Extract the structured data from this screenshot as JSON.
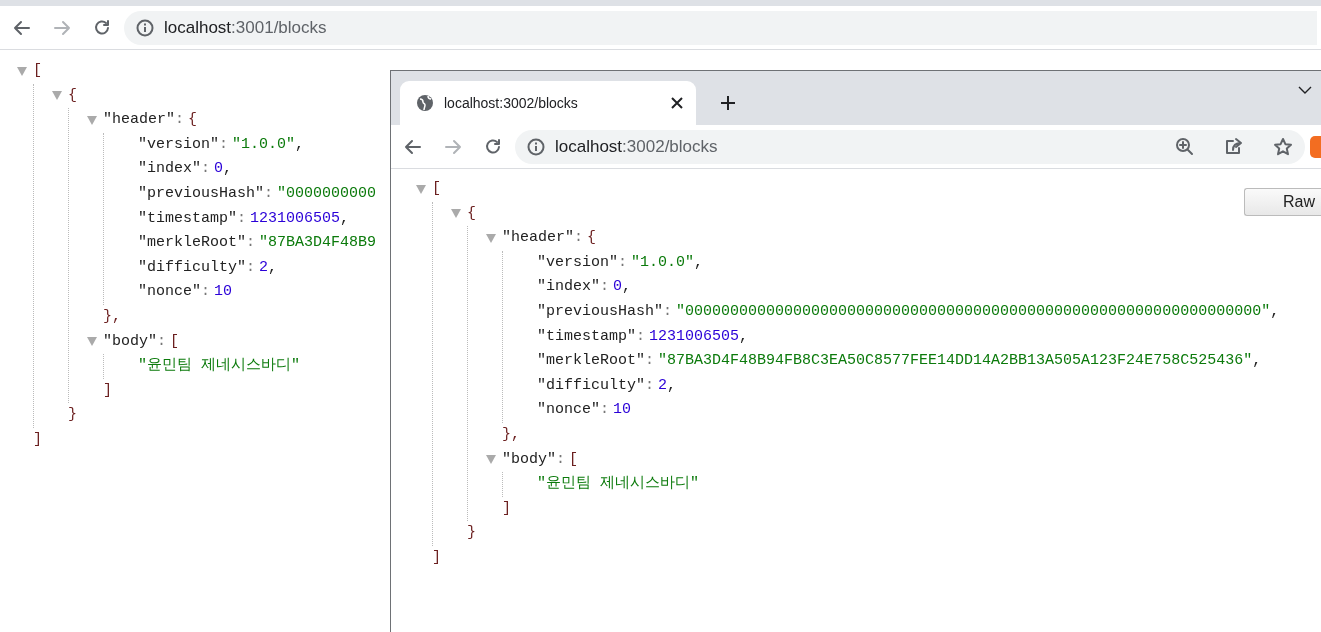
{
  "back_window": {
    "address": {
      "host": "localhost",
      "path": ":3001/blocks"
    },
    "json_view": {
      "kind": "container",
      "open": "[",
      "expanded": true,
      "close": "]",
      "children": [
        {
          "kind": "container",
          "open": "{",
          "expanded": true,
          "close": "}",
          "children": [
            {
              "kind": "container",
              "key": "\"header\"",
              "colon": ":",
              "open": "{",
              "expanded": true,
              "close": "},",
              "children": [
                {
                  "kind": "string",
                  "key": "\"version\"",
                  "colon": ":",
                  "value": "\"1.0.0\"",
                  "comma": ","
                },
                {
                  "kind": "number",
                  "key": "\"index\"",
                  "colon": ":",
                  "value": "0",
                  "comma": ","
                },
                {
                  "kind": "string",
                  "key": "\"previousHash\"",
                  "colon": ":",
                  "value": "\"0000000000"
                },
                {
                  "kind": "number",
                  "key": "\"timestamp\"",
                  "colon": ":",
                  "value": "1231006505",
                  "comma": ","
                },
                {
                  "kind": "string",
                  "key": "\"merkleRoot\"",
                  "colon": ":",
                  "value": "\"87BA3D4F48B9"
                },
                {
                  "kind": "number",
                  "key": "\"difficulty\"",
                  "colon": ":",
                  "value": "2",
                  "comma": ","
                },
                {
                  "kind": "number",
                  "key": "\"nonce\"",
                  "colon": ":",
                  "value": "10"
                }
              ]
            },
            {
              "kind": "container",
              "key": "\"body\"",
              "colon": ":",
              "open": "[",
              "expanded": true,
              "close": "]",
              "children": [
                {
                  "kind": "string",
                  "value": "\"윤민팀 제네시스바디\""
                }
              ]
            }
          ]
        }
      ]
    }
  },
  "front_window": {
    "tab": {
      "title": "localhost:3002/blocks",
      "selected": true
    },
    "address": {
      "host": "localhost",
      "path": ":3002/blocks"
    },
    "raw_button": "Raw",
    "json_view": {
      "kind": "container",
      "open": "[",
      "expanded": true,
      "close": "]",
      "children": [
        {
          "kind": "container",
          "open": "{",
          "expanded": true,
          "close": "}",
          "children": [
            {
              "kind": "container",
              "key": "\"header\"",
              "colon": ":",
              "open": "{",
              "expanded": true,
              "close": "},",
              "children": [
                {
                  "kind": "string",
                  "key": "\"version\"",
                  "colon": ":",
                  "value": "\"1.0.0\"",
                  "comma": ","
                },
                {
                  "kind": "number",
                  "key": "\"index\"",
                  "colon": ":",
                  "value": "0",
                  "comma": ","
                },
                {
                  "kind": "string",
                  "key": "\"previousHash\"",
                  "colon": ":",
                  "value": "\"0000000000000000000000000000000000000000000000000000000000000000\"",
                  "comma": ","
                },
                {
                  "kind": "number",
                  "key": "\"timestamp\"",
                  "colon": ":",
                  "value": "1231006505",
                  "comma": ","
                },
                {
                  "kind": "string",
                  "key": "\"merkleRoot\"",
                  "colon": ":",
                  "value": "\"87BA3D4F48B94FB8C3EA50C8577FEE14DD14A2BB13A505A123F24E758C525436\"",
                  "comma": ","
                },
                {
                  "kind": "number",
                  "key": "\"difficulty\"",
                  "colon": ":",
                  "value": "2",
                  "comma": ","
                },
                {
                  "kind": "number",
                  "key": "\"nonce\"",
                  "colon": ":",
                  "value": "10"
                }
              ]
            },
            {
              "kind": "container",
              "key": "\"body\"",
              "colon": ":",
              "open": "[",
              "expanded": true,
              "close": "]",
              "children": [
                {
                  "kind": "string",
                  "value": "\"윤민팀 제네시스바디\""
                }
              ]
            }
          ]
        }
      ]
    }
  }
}
